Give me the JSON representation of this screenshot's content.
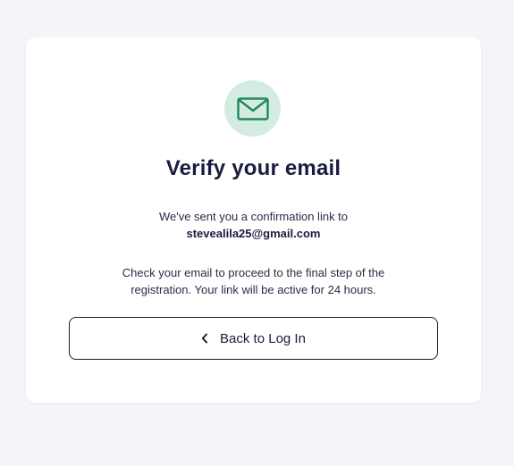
{
  "card": {
    "icon": "envelope-icon",
    "title": "Verify your email",
    "sent_text": "We've sent you a confirmation link to",
    "email": "stevealila25@gmail.com",
    "instructions": "Check your email to proceed to the final step of the registration. Your link will be active for 24 hours.",
    "back_button": {
      "icon": "chevron-left-icon",
      "label": "Back to Log In"
    }
  },
  "colors": {
    "page_background": "#f4f5f8",
    "card_background": "#ffffff",
    "icon_circle": "#d4ebe2",
    "icon_stroke": "#1f8a5c",
    "text_primary": "#1a1c3d"
  }
}
